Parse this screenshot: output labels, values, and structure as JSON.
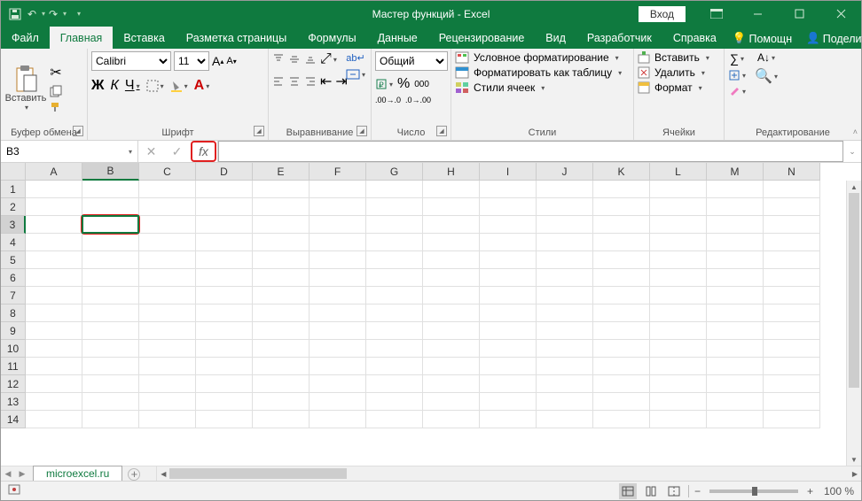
{
  "title": "Мастер функций  -  Excel",
  "titlebar": {
    "login": "Вход"
  },
  "tabs": {
    "file": "Файл",
    "home": "Главная",
    "insert": "Вставка",
    "page": "Разметка страницы",
    "formulas": "Формулы",
    "data": "Данные",
    "review": "Рецензирование",
    "view": "Вид",
    "developer": "Разработчик",
    "help": "Справка",
    "tell_me": "Помощн",
    "share": "Поделиться"
  },
  "ribbon": {
    "clipboard": {
      "paste": "Вставить",
      "label": "Буфер обмена"
    },
    "font": {
      "name": "Calibri",
      "size": "11",
      "bold": "Ж",
      "italic": "К",
      "underline": "Ч",
      "label": "Шрифт"
    },
    "align": {
      "label": "Выравнивание"
    },
    "number": {
      "format": "Общий",
      "label": "Число"
    },
    "styles": {
      "cond": "Условное форматирование",
      "table": "Форматировать как таблицу",
      "cell": "Стили ячеек",
      "label": "Стили"
    },
    "cells": {
      "insert": "Вставить",
      "delete": "Удалить",
      "format": "Формат",
      "label": "Ячейки"
    },
    "editing": {
      "label": "Редактирование"
    }
  },
  "namebox": "B3",
  "fx": "fx",
  "columns": [
    "A",
    "B",
    "C",
    "D",
    "E",
    "F",
    "G",
    "H",
    "I",
    "J",
    "K",
    "L",
    "M",
    "N"
  ],
  "rows": [
    1,
    2,
    3,
    4,
    5,
    6,
    7,
    8,
    9,
    10,
    11,
    12,
    13,
    14
  ],
  "active_cell": {
    "col": 1,
    "row": 2
  },
  "sheet_tab": "microexcel.ru",
  "status": {
    "zoom": "100 %",
    "minus": "−",
    "plus": "+"
  }
}
